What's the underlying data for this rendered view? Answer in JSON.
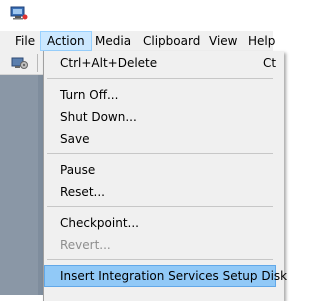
{
  "menubar": {
    "items": [
      "File",
      "Action",
      "Media",
      "Clipboard",
      "View",
      "Help"
    ]
  },
  "action_menu": {
    "ctrl_alt_delete": "Ctrl+Alt+Delete",
    "ctrl_alt_delete_shortcut": "Ct",
    "turn_off": "Turn Off...",
    "shut_down": "Shut Down...",
    "save": "Save",
    "pause": "Pause",
    "reset": "Reset...",
    "checkpoint": "Checkpoint...",
    "revert": "Revert...",
    "insert_integration": "Insert Integration Services Setup Disk"
  },
  "icons": {
    "app": "hyper-v-vm-icon",
    "toolbar": "ctrl-alt-del-icon"
  },
  "colors": {
    "menu_active_bg": "#cce8ff",
    "highlight_bg": "#91c9f7",
    "vm_background": "#7f8d9d"
  }
}
